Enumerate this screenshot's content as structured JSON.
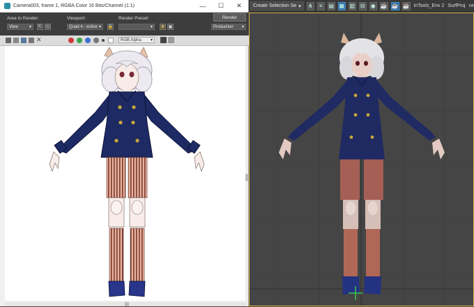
{
  "render_window": {
    "title": "Camera003, frame 1, RGBA Color 16 Bits/Channel (1:1)",
    "window_controls": {
      "minimize": "—",
      "maximize": "☐",
      "close": "✕"
    },
    "area_to_render": {
      "label": "Area to Render:",
      "value": "View"
    },
    "viewport": {
      "label": "Viewport:",
      "value": "Quad 4 - ective"
    },
    "render_preset": {
      "label": "Render Preset:",
      "value": ""
    },
    "render_button": "Render",
    "production": "Production",
    "channel_display": "RGB Alpha"
  },
  "app_toolbar": {
    "selection_set": "Create Selection Se",
    "items": [
      "inTools_Env 2",
      "SurfProj"
    ],
    "trailing": "ce"
  },
  "colors": {
    "coat": "#1e2a63",
    "buttons": "#c9a63a",
    "stockings": "#b5685a",
    "hair": "#e9e9ee",
    "skin_flat": "#f7e9e6",
    "skin_3d": "#e2c9c2",
    "shoes": "#27358a",
    "viewport_border": "#d7b74b"
  }
}
